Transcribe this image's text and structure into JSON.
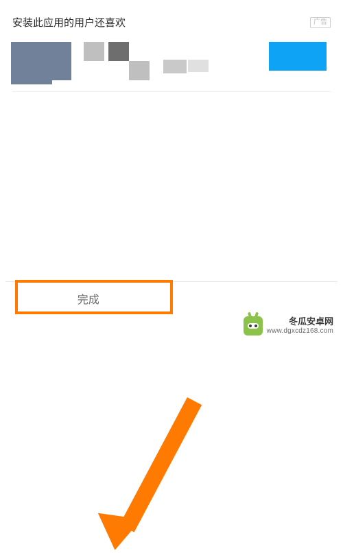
{
  "recommendations": {
    "title": "安装此应用的用户还喜欢",
    "ad_badge": "广告"
  },
  "bottom_bar": {
    "done_label": "完成",
    "right_label": ""
  },
  "watermark": {
    "name": "冬瓜安卓网",
    "url": "www.dgxcdz168.com"
  },
  "annotation": {
    "highlight_target": "done-button",
    "arrow_direction": "down-left"
  }
}
